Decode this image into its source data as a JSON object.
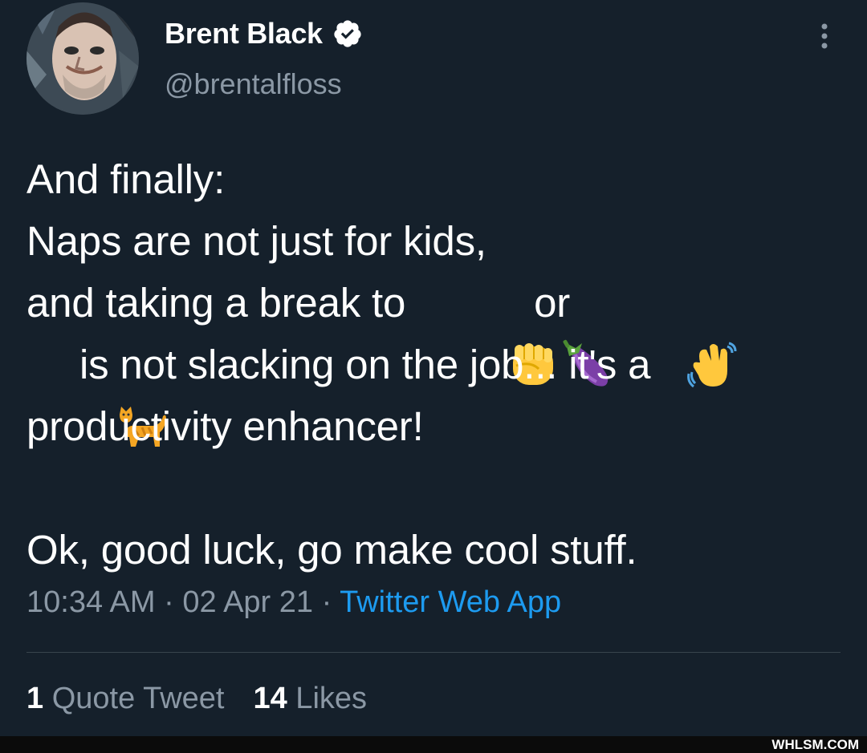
{
  "author": {
    "display_name": "Brent Black",
    "handle": "@brentalfloss",
    "verified": true
  },
  "tweet": {
    "line1": "And finally:",
    "line2": "Naps are not just for kids,",
    "line3_a": "and taking a break to ",
    "line3_b": " or ",
    "line4": "is not slacking on the job... it's a",
    "line5": "productivity enhancer!",
    "line6": "Ok, good luck, go make cool stuff.",
    "emojis": [
      "raised-fist",
      "eggplant",
      "waving-hand",
      "cat"
    ]
  },
  "meta": {
    "time": "10:34 AM",
    "sep1": " · ",
    "date": "02 Apr 21",
    "sep2": " · ",
    "source": "Twitter Web App"
  },
  "stats": {
    "quote_count": "1",
    "quote_label": " Quote Tweet",
    "like_count": "14",
    "like_label": " Likes"
  },
  "watermark": "WHLSM.COM",
  "colors": {
    "background": "#15202b",
    "text": "#ffffff",
    "secondary": "#8b98a5",
    "link": "#1d9bf0",
    "divider": "#38444d"
  }
}
